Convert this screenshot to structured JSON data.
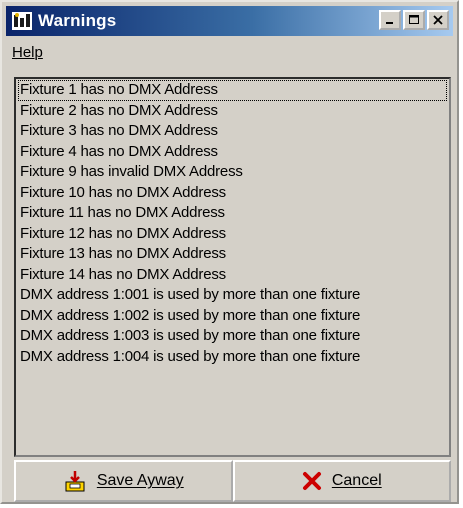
{
  "window": {
    "title": "Warnings",
    "app_icon": "dmx-app-icon",
    "controls": {
      "minimize": "_",
      "maximize": "□",
      "close": "×"
    }
  },
  "menu": {
    "items": [
      {
        "label": "Help"
      }
    ]
  },
  "warnings": [
    "Fixture 1 has no DMX Address",
    "Fixture 2 has no DMX Address",
    "Fixture 3 has no DMX Address",
    "Fixture 4 has no DMX Address",
    "Fixture 9 has invalid DMX Address",
    "Fixture 10 has no DMX Address",
    "Fixture 11 has no DMX Address",
    "Fixture 12 has no DMX Address",
    "Fixture 13 has no DMX Address",
    "Fixture 14 has no DMX Address",
    "DMX address 1:001 is used by more than one fixture",
    "DMX address 1:002 is used by more than one fixture",
    "DMX address 1:003 is used by more than one fixture",
    "DMX address 1:004 is used by more than one fixture"
  ],
  "buttons": {
    "save": {
      "label": "Save Ayway",
      "icon": "save-warning-icon"
    },
    "cancel": {
      "label": "Cancel",
      "icon": "red-x-icon",
      "icon_color": "#cc0000"
    }
  },
  "colors": {
    "titlebar_start": "#0a246a",
    "titlebar_end": "#a6caf0",
    "face": "#d4d0c8"
  }
}
